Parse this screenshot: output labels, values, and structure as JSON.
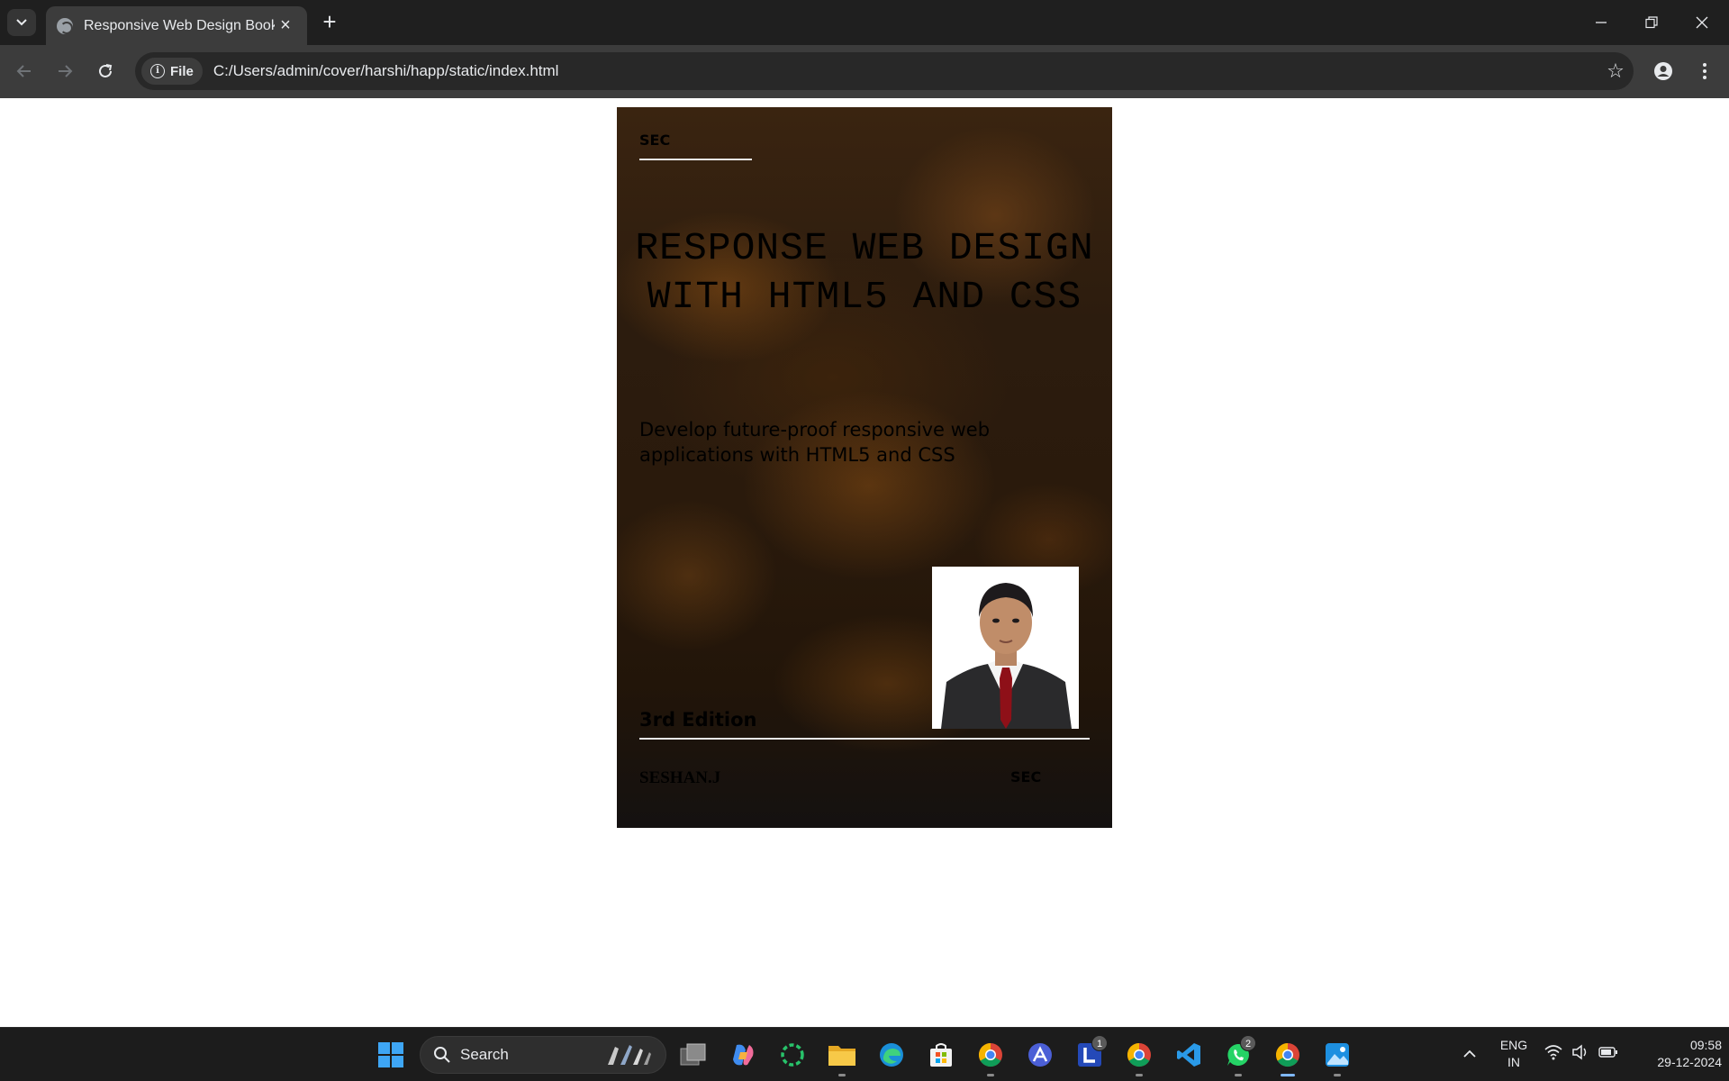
{
  "browser": {
    "tab_title": "Responsive Web Design Book",
    "new_tab_symbol": "+",
    "site_chip_label": "File",
    "url": "C:/Users/admin/cover/harshi/happ/static/index.html"
  },
  "cover": {
    "top_left_label": "SEC",
    "title": "RESPONSE WEB DESIGN WITH HTML5 AND CSS",
    "subtitle": "Develop future-proof responsive web applications with HTML5 and CSS",
    "edition": "3rd Edition",
    "author": "SESHAN.J",
    "bottom_right_label": "SEC",
    "photo_icon": "author-portrait"
  },
  "taskbar": {
    "search_label": "Search",
    "apps": [
      {
        "name": "task-view",
        "badge": ""
      },
      {
        "name": "copilot",
        "badge": ""
      },
      {
        "name": "loading-app",
        "badge": ""
      },
      {
        "name": "file-explorer",
        "badge": ""
      },
      {
        "name": "edge",
        "badge": ""
      },
      {
        "name": "microsoft-store",
        "badge": ""
      },
      {
        "name": "chrome-profile",
        "badge": ""
      },
      {
        "name": "app-a",
        "badge": ""
      },
      {
        "name": "l-app",
        "badge": "1"
      },
      {
        "name": "chrome-2",
        "badge": ""
      },
      {
        "name": "vscode",
        "badge": ""
      },
      {
        "name": "whatsapp",
        "badge": "2"
      },
      {
        "name": "chrome",
        "badge": ""
      },
      {
        "name": "photos",
        "badge": ""
      }
    ],
    "lang_line1": "ENG",
    "lang_line2": "IN",
    "time": "09:58",
    "date": "29-12-2024"
  },
  "colors": {
    "chrome_dark": "#1f1f1f",
    "chrome_toolbar": "#3c3c3c",
    "taskbar": "#1c1c1c",
    "cover_brown": "#2c1c0e"
  }
}
